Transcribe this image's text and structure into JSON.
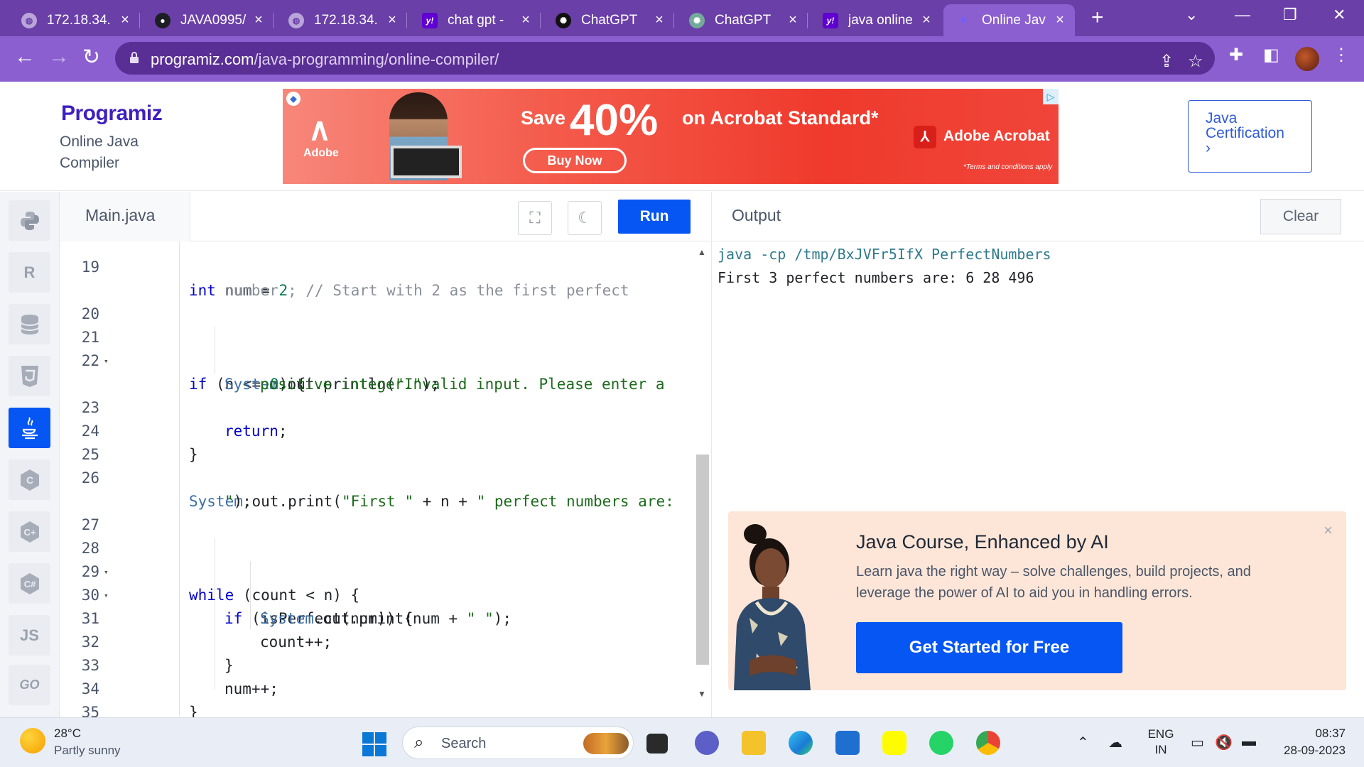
{
  "browser": {
    "tabs": [
      {
        "title": "172.18.34.",
        "icon": "globe-icon"
      },
      {
        "title": "JAVA0995/",
        "icon": "github-icon"
      },
      {
        "title": "172.18.34.",
        "icon": "globe-icon"
      },
      {
        "title": "chat gpt -",
        "icon": "yahoo-icon"
      },
      {
        "title": "ChatGPT",
        "icon": "chatgpt-icon"
      },
      {
        "title": "ChatGPT",
        "icon": "chatgpt-icon"
      },
      {
        "title": "java online",
        "icon": "yahoo-icon"
      },
      {
        "title": "Online Jav",
        "icon": "programiz-icon"
      }
    ],
    "active_tab": 7,
    "url_host": "programiz.com",
    "url_path": "/java-programming/online-compiler/"
  },
  "header": {
    "logo": "Programiz",
    "subtitle_line1": "Online Java",
    "subtitle_line2": "Compiler",
    "cert_line1": "Java",
    "cert_line2": "Certification",
    "cert_arrow": "›"
  },
  "ad": {
    "brand": "Adobe",
    "save": "Save",
    "percent": "40%",
    "product": "on Acrobat Standard*",
    "button": "Buy Now",
    "acrobat": "Adobe Acrobat",
    "terms": "*Terms and conditions apply"
  },
  "languages": [
    "python",
    "r",
    "sql",
    "html",
    "java",
    "c",
    "cpp",
    "csharp",
    "js",
    "go"
  ],
  "languages_text": {
    "js": "JS",
    "go": "GO"
  },
  "editor": {
    "filename": "Main.java",
    "run": "Run",
    "lines": [
      {
        "n": "19",
        "fold": ""
      },
      {
        "n": "",
        "fold": ""
      },
      {
        "n": "20",
        "fold": ""
      },
      {
        "n": "21",
        "fold": "▾"
      },
      {
        "n": "22",
        "fold": ""
      },
      {
        "n": "",
        "fold": ""
      },
      {
        "n": "23",
        "fold": ""
      },
      {
        "n": "24",
        "fold": ""
      },
      {
        "n": "25",
        "fold": ""
      },
      {
        "n": "26",
        "fold": ""
      },
      {
        "n": "",
        "fold": ""
      },
      {
        "n": "27",
        "fold": ""
      },
      {
        "n": "28",
        "fold": "▾"
      },
      {
        "n": "29",
        "fold": "▾"
      },
      {
        "n": "30",
        "fold": ""
      },
      {
        "n": "31",
        "fold": ""
      },
      {
        "n": "32",
        "fold": ""
      },
      {
        "n": "33",
        "fold": ""
      },
      {
        "n": "34",
        "fold": ""
      },
      {
        "n": "35",
        "fold": ""
      }
    ],
    "code": {
      "l19a": "int",
      "l19b": " num = ",
      "l19c": "2",
      "l19d": "; // Start with 2 as the first perfect",
      "l19e": "number",
      "l21a": "if",
      "l21b": " (n <= ",
      "l21c": "0",
      "l21d": ") {",
      "l22a": "System",
      "l22b": ".out.println(",
      "l22c": "\"Invalid input. Please enter a",
      "l22d": "positive integer.\"",
      "l22e": ");",
      "l23a": "return",
      "l23b": ";",
      "l24": "}",
      "l26a": "System",
      "l26b": ".out.print(",
      "l26c": "\"First \"",
      "l26d": " + n + ",
      "l26e": "\" perfect numbers are:",
      "l26f": "\"",
      "l26g": ");",
      "l28a": "while",
      "l28b": " (count < n) {",
      "l29a": "if",
      "l29b": " (isPerfect(num)) {",
      "l30a": "System",
      "l30b": ".out.print(num + ",
      "l30c": "\" \"",
      "l30d": ");",
      "l31": "count++;",
      "l32": "}",
      "l33": "num++;",
      "l34": "}",
      "l35": "}"
    }
  },
  "output": {
    "label": "Output",
    "clear": "Clear",
    "command": "java -cp /tmp/BxJVFr5IfX PerfectNumbers",
    "result": "First 3 perfect numbers are: 6 28 496"
  },
  "promo": {
    "title": "Java Course, Enhanced by AI",
    "text_line1": "Learn java the right way – solve challenges, build projects, and",
    "text_line2": "leverage the power of AI to aid you in handling errors.",
    "button": "Get Started for Free",
    "close": "×"
  },
  "taskbar": {
    "temperature": "28°C",
    "weather": "Partly sunny",
    "search": "Search",
    "lang_line1": "ENG",
    "lang_line2": "IN",
    "time": "08:37",
    "date": "28-09-2023"
  }
}
